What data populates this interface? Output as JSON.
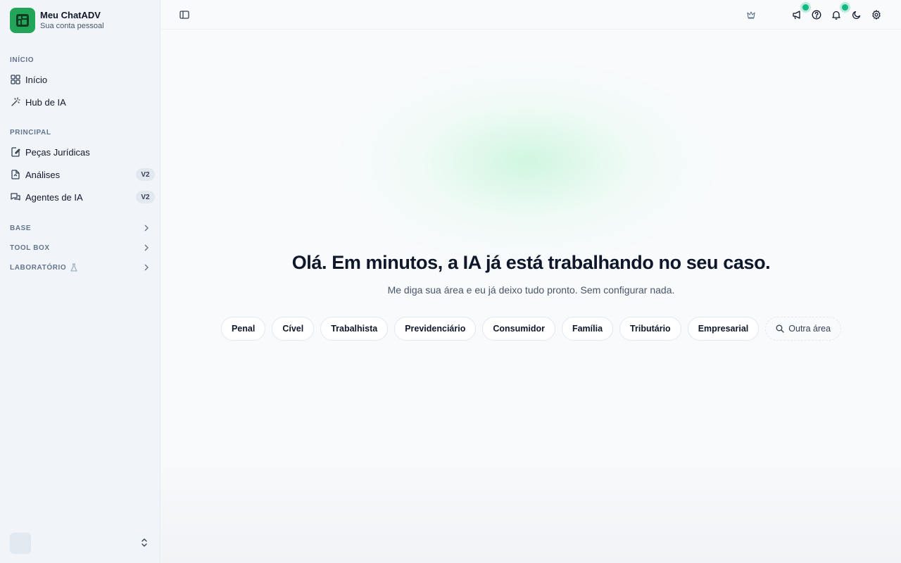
{
  "brand": {
    "name": "Meu ChatADV",
    "subtitle": "Sua conta pessoal"
  },
  "sidebar": {
    "sections": {
      "inicio": "INÍCIO",
      "principal": "PRINCIPAL",
      "base": "BASE",
      "toolbox": "TOOL BOX",
      "laboratorio": "LABORATÓRIO"
    },
    "items": [
      {
        "label": "Início",
        "icon": "grid-icon"
      },
      {
        "label": "Hub de IA",
        "icon": "magic-wand-icon"
      },
      {
        "label": "Peças Jurídicas",
        "icon": "document-edit-icon"
      },
      {
        "label": "Análises",
        "icon": "document-analysis-icon",
        "badge": "V2"
      },
      {
        "label": "Agentes de IA",
        "icon": "chat-agents-icon",
        "badge": "V2"
      }
    ]
  },
  "main": {
    "title": "Olá. Em minutos, a IA já está trabalhando no seu caso.",
    "subtitle": "Me diga sua área e eu já deixo tudo pronto. Sem configurar nada.",
    "chips": [
      "Penal",
      "Cível",
      "Trabalhista",
      "Previdenciário",
      "Consumidor",
      "Família",
      "Tributário",
      "Empresarial"
    ],
    "other_chip": "Outra área"
  },
  "colors": {
    "accent": "#22a559",
    "indicator": "#10b981"
  }
}
